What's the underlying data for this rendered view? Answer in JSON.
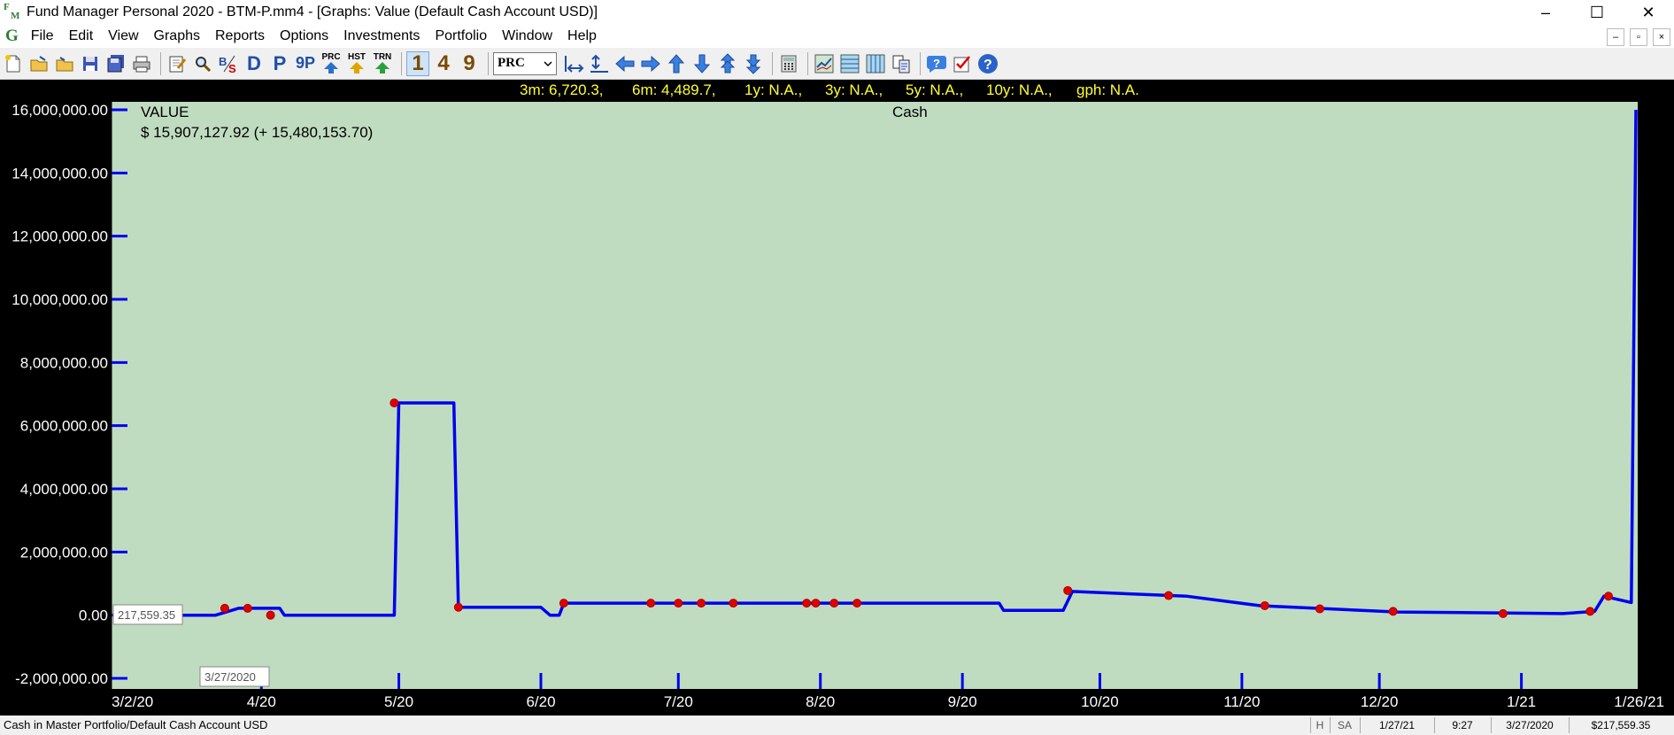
{
  "window": {
    "title": "Fund Manager Personal 2020 - BTM-P.mm4 - [Graphs: Value (Default Cash Account USD)]",
    "logo_top": "F",
    "logo_bottom": "M",
    "minimize": "–",
    "maximize": "☐",
    "close": "✕"
  },
  "menu": {
    "logo": "G",
    "items": [
      "File",
      "Edit",
      "View",
      "Graphs",
      "Reports",
      "Options",
      "Investments",
      "Portfolio",
      "Window",
      "Help"
    ],
    "mdi_min": "–",
    "mdi_restore": "▫",
    "mdi_close": "×"
  },
  "toolbar": {
    "btn_d": "D",
    "btn_p": "P",
    "btn_9p": "9P",
    "btn_prc": "PRC",
    "btn_hst": "HST",
    "btn_trn": "TRN",
    "btn_1": "1",
    "btn_4": "4",
    "btn_9": "9",
    "prc_select": "PRC",
    "help_label": "?"
  },
  "stats": {
    "m3": "3m: 6,720.3,",
    "m6": "6m: 4,489.7,",
    "y1": "1y: N.A.,",
    "y3": "3y: N.A.,",
    "y5": "5y: N.A.,",
    "y10": "10y: N.A.,",
    "gph": "gph: N.A."
  },
  "chart_data": {
    "type": "line",
    "title": "Cash",
    "value_label": "VALUE",
    "value_text": "$ 15,907,127.92 (+ 15,480,153.70)",
    "ylim": [
      -2000000,
      16000000
    ],
    "xlim": [
      "2020-03-02",
      "2021-01-26"
    ],
    "y_ticks": [
      "-2,000,000.00",
      "0.00",
      "2,000,000.00",
      "4,000,000.00",
      "6,000,000.00",
      "8,000,000.00",
      "10,000,000.00",
      "12,000,000.00",
      "14,000,000.00",
      "16,000,000.00"
    ],
    "y_tick_values": [
      -2000000,
      0,
      2000000,
      4000000,
      6000000,
      8000000,
      10000000,
      12000000,
      14000000,
      16000000
    ],
    "x_ticks": [
      "3/2/20",
      "4/20",
      "5/20",
      "6/20",
      "7/20",
      "8/20",
      "9/20",
      "10/20",
      "11/20",
      "12/20",
      "1/21",
      "1/26/21"
    ],
    "x_tick_dates": [
      "2020-03-02",
      "2020-04-01",
      "2020-05-01",
      "2020-06-01",
      "2020-07-01",
      "2020-08-01",
      "2020-09-01",
      "2020-10-01",
      "2020-11-01",
      "2020-12-01",
      "2021-01-01",
      "2021-01-26"
    ],
    "series": [
      {
        "color": "#0000ee",
        "points": [
          [
            "2020-03-02",
            0
          ],
          [
            "2020-03-22",
            0
          ],
          [
            "2020-03-27",
            217559
          ],
          [
            "2020-04-05",
            217559
          ],
          [
            "2020-04-06",
            0
          ],
          [
            "2020-04-30",
            0
          ],
          [
            "2020-05-01",
            6720000
          ],
          [
            "2020-05-13",
            6720000
          ],
          [
            "2020-05-14",
            250000
          ],
          [
            "2020-06-01",
            250000
          ],
          [
            "2020-06-03",
            0
          ],
          [
            "2020-06-05",
            0
          ],
          [
            "2020-06-06",
            380000
          ],
          [
            "2020-09-09",
            380000
          ],
          [
            "2020-09-10",
            150000
          ],
          [
            "2020-09-23",
            150000
          ],
          [
            "2020-09-25",
            750000
          ],
          [
            "2020-10-20",
            600000
          ],
          [
            "2020-11-05",
            300000
          ],
          [
            "2020-12-05",
            100000
          ],
          [
            "2021-01-10",
            50000
          ],
          [
            "2021-01-17",
            120000
          ],
          [
            "2021-01-19",
            600000
          ],
          [
            "2021-01-25",
            400000
          ],
          [
            "2021-01-26",
            16000000
          ]
        ]
      }
    ],
    "markers": [
      [
        "2020-03-24",
        217559
      ],
      [
        "2020-03-29",
        217559
      ],
      [
        "2020-04-03",
        0
      ],
      [
        "2020-04-30",
        6720000
      ],
      [
        "2020-05-14",
        250000
      ],
      [
        "2020-06-06",
        380000
      ],
      [
        "2020-06-25",
        380000
      ],
      [
        "2020-07-01",
        380000
      ],
      [
        "2020-07-06",
        380000
      ],
      [
        "2020-07-13",
        380000
      ],
      [
        "2020-07-29",
        380000
      ],
      [
        "2020-07-31",
        380000
      ],
      [
        "2020-08-04",
        380000
      ],
      [
        "2020-08-09",
        380000
      ],
      [
        "2020-09-24",
        780000
      ],
      [
        "2020-10-16",
        620000
      ],
      [
        "2020-11-06",
        300000
      ],
      [
        "2020-11-18",
        200000
      ],
      [
        "2020-12-04",
        120000
      ],
      [
        "2020-12-28",
        50000
      ],
      [
        "2021-01-16",
        120000
      ],
      [
        "2021-01-20",
        600000
      ]
    ],
    "cursor_value": "217,559.35",
    "cursor_date": "3/27/2020",
    "background": "#c0dcc0",
    "grid": false
  },
  "status": {
    "main": "Cash in Master Portfolio/Default Cash Account USD",
    "h": "H",
    "sa": "SA",
    "date1": "1/27/21",
    "time": "9:27",
    "date2": "3/27/2020",
    "value": "$217,559.35"
  }
}
